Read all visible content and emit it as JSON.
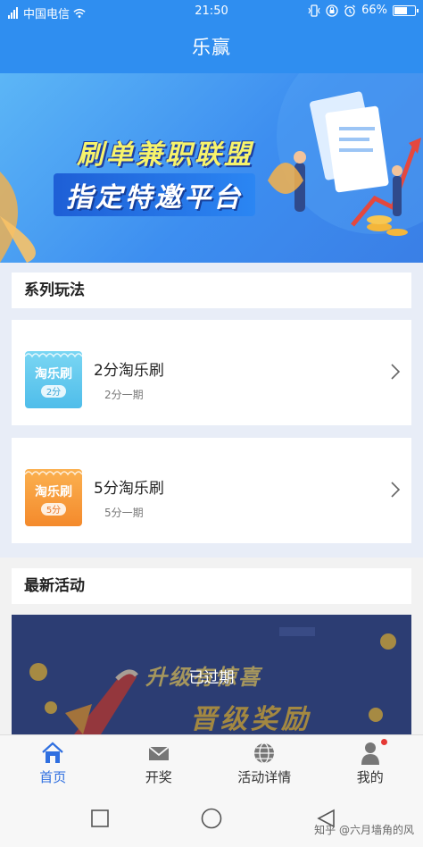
{
  "status_bar": {
    "carrier": "中国电信",
    "time": "21:50",
    "battery": "66%",
    "battery_level": 0.66
  },
  "app_bar": {
    "title": "乐赢"
  },
  "banner": {
    "line1": "刷单兼职联盟",
    "line2": "指定特邀平台"
  },
  "series_section": {
    "title": "系列玩法",
    "items": [
      {
        "title": "2分淘乐刷",
        "sub": "2分一期",
        "thumb_text": "淘乐刷",
        "thumb_badge": "2分",
        "thumb_color": "#5ec8ef"
      },
      {
        "title": "5分淘乐刷",
        "sub": "5分一期",
        "thumb_text": "淘乐刷",
        "thumb_badge": "5分",
        "thumb_color": "#f7a23b"
      }
    ]
  },
  "activity_section": {
    "title": "最新活动",
    "promo_line1": "升级有惊喜",
    "promo_line2": "晋级奖励",
    "status": "已过期"
  },
  "tabbar": {
    "items": [
      {
        "label": "首页",
        "icon": "home-icon",
        "active": true
      },
      {
        "label": "开奖",
        "icon": "envelope-icon",
        "active": false
      },
      {
        "label": "活动详情",
        "icon": "globe-icon",
        "active": false
      },
      {
        "label": "我的",
        "icon": "user-icon",
        "active": false
      }
    ]
  },
  "watermark": "知乎 @六月墙角的风",
  "colors": {
    "primary": "#2f8ef0",
    "tab_active": "#2f6fe0"
  }
}
